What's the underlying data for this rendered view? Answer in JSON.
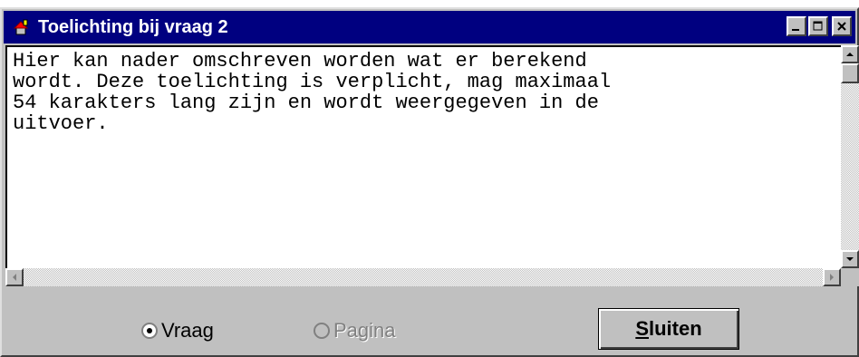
{
  "window": {
    "title": "Toelichting bij vraag 2",
    "buttons": {
      "minimize": "_",
      "maximize": "□",
      "close": "×"
    }
  },
  "editor": {
    "lines": [
      "Hier kan nader omschreven worden wat er berekend",
      "wordt. Deze toelichting is verplicht, mag maximaal",
      "54 karakters lang zijn en wordt weergegeven in de",
      "uitvoer."
    ]
  },
  "options": {
    "vraag": {
      "label": "Vraag",
      "selected": true
    },
    "pagina": {
      "label": "Pagina",
      "disabled": true
    }
  },
  "close_button": {
    "mnemonic": "S",
    "rest": "luiten"
  },
  "icons": {
    "app": "app-icon",
    "scroll_up": "triangle-up",
    "scroll_down": "triangle-down",
    "scroll_left": "triangle-left",
    "scroll_right": "triangle-right"
  }
}
